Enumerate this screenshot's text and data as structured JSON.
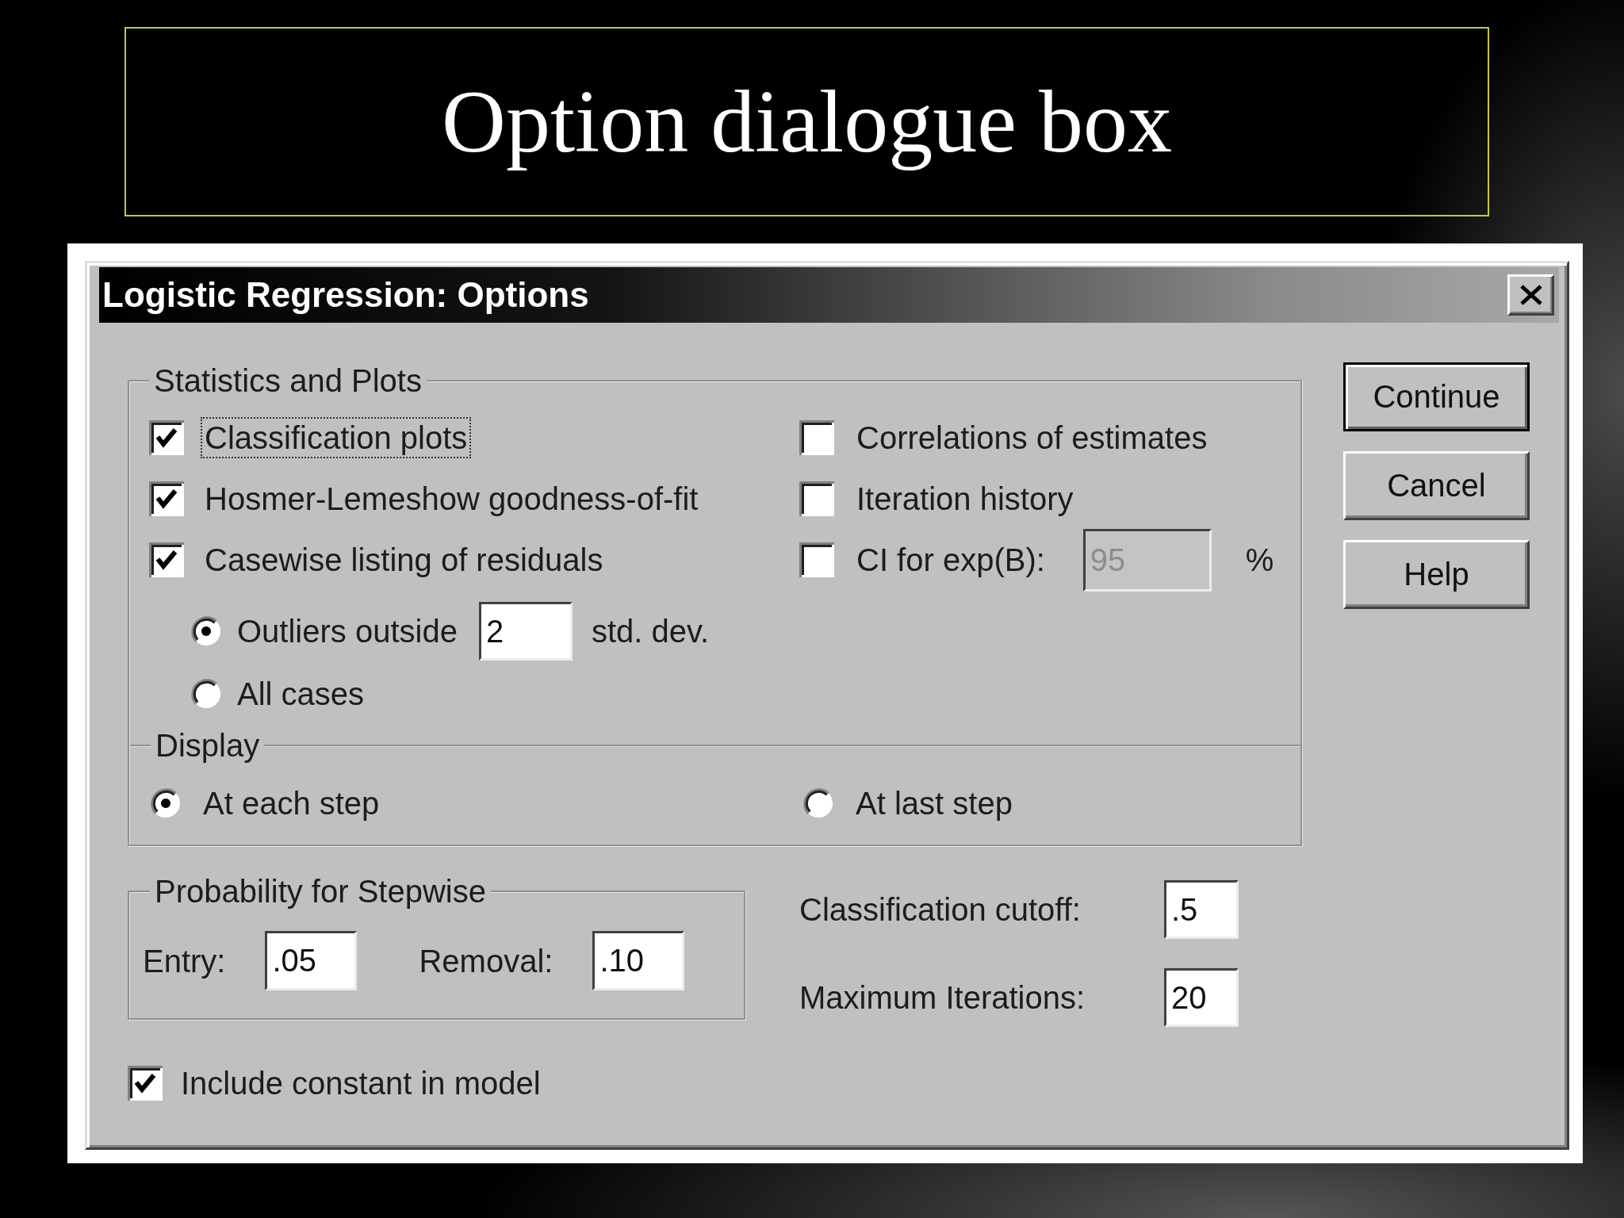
{
  "slide": {
    "title": "Option dialogue box"
  },
  "dialog": {
    "title": "Logistic Regression: Options",
    "statistics_and_plots": {
      "legend": "Statistics and Plots",
      "left_options": [
        {
          "label": "Classification plots",
          "checked": true,
          "focused": true
        },
        {
          "label": "Hosmer-Lemeshow goodness-of-fit",
          "checked": true,
          "focused": false
        },
        {
          "label": "Casewise listing of residuals",
          "checked": true,
          "focused": false
        }
      ],
      "residual_options": [
        {
          "label": "Outliers outside",
          "selected": true,
          "field": {
            "value": "2",
            "disabled": false
          },
          "suffix": "std. dev."
        },
        {
          "label": "All cases",
          "selected": false
        }
      ],
      "right_options": [
        {
          "label": "Correlations of estimates",
          "checked": false,
          "focused": false
        },
        {
          "label": "Iteration history",
          "checked": false,
          "focused": false
        },
        {
          "label": "CI for exp(B):",
          "checked": false,
          "focused": false,
          "field": {
            "value": "95",
            "disabled": true
          },
          "suffix": "%"
        }
      ]
    },
    "display": {
      "legend": "Display",
      "options": [
        {
          "label": "At each step",
          "selected": true
        },
        {
          "label": "At last step",
          "selected": false
        }
      ]
    },
    "probability": {
      "legend": "Probability for Stepwise",
      "fields": [
        {
          "label": "Entry:",
          "value": ".05"
        },
        {
          "label": "Removal:",
          "value": ".10"
        }
      ]
    },
    "settings": [
      {
        "label": "Classification cutoff:",
        "value": ".5"
      },
      {
        "label": "Maximum Iterations:",
        "value": "20"
      }
    ],
    "include_constant": {
      "label": "Include constant in model",
      "checked": true
    },
    "buttons": [
      {
        "label": "Continue",
        "default": true
      },
      {
        "label": "Cancel",
        "default": false
      },
      {
        "label": "Help",
        "default": false
      }
    ]
  }
}
